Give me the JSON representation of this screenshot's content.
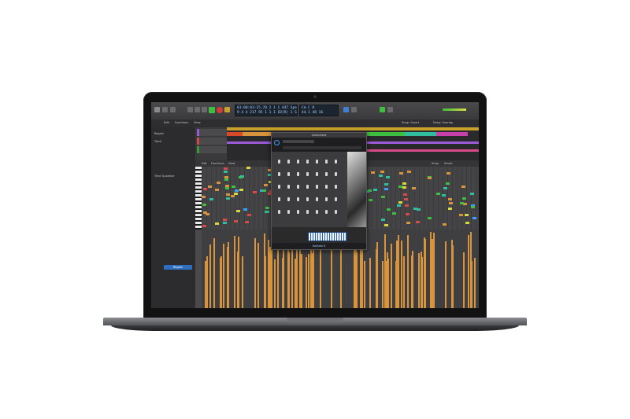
{
  "window": {
    "plugin_title": "Instrument",
    "plugin_footer": "Kontakt 6"
  },
  "transport": {
    "lcd_line1": "01:00:03:15.70    2  1  1    447   Speed-Only  104.0000   4/4   Cmaj",
    "lcd_line2": "9  4  4  217       95  1  1    1    ID(R) 1  Sample Rate  48000",
    "lcd2_line1": "Cm  C  R",
    "lcd2_line2": "44.1  48  16"
  },
  "control_bar": {
    "edit_label": "Edit",
    "functions_label": "Functions",
    "view_label": "View",
    "snap_label": "Snap: Smart",
    "drag_label": "Drag: Overlap"
  },
  "inspector": {
    "region_label": "Region",
    "track_label": "Track",
    "notes_label": "Time Quantize",
    "status_button": "Region"
  },
  "piano_roll": {
    "header_labels": [
      "Edit",
      "Functions",
      "View"
    ],
    "right_labels": [
      "Snap",
      "Smart"
    ]
  },
  "colors": {
    "accent_blue": "#2f6fbf",
    "ruler_gold": "#c9a12a",
    "velocity_orange": "#d8943c",
    "play_green": "#3fbf3f",
    "record_red": "#d63a3a"
  },
  "icons": [
    "library-icon",
    "mixer-icon",
    "rewind-icon",
    "fast-forward-icon",
    "stop-icon",
    "play-icon",
    "record-icon",
    "cycle-icon",
    "metronome-icon",
    "list-icon",
    "note-icon",
    "loop-icon",
    "browser-icon",
    "power-icon"
  ]
}
